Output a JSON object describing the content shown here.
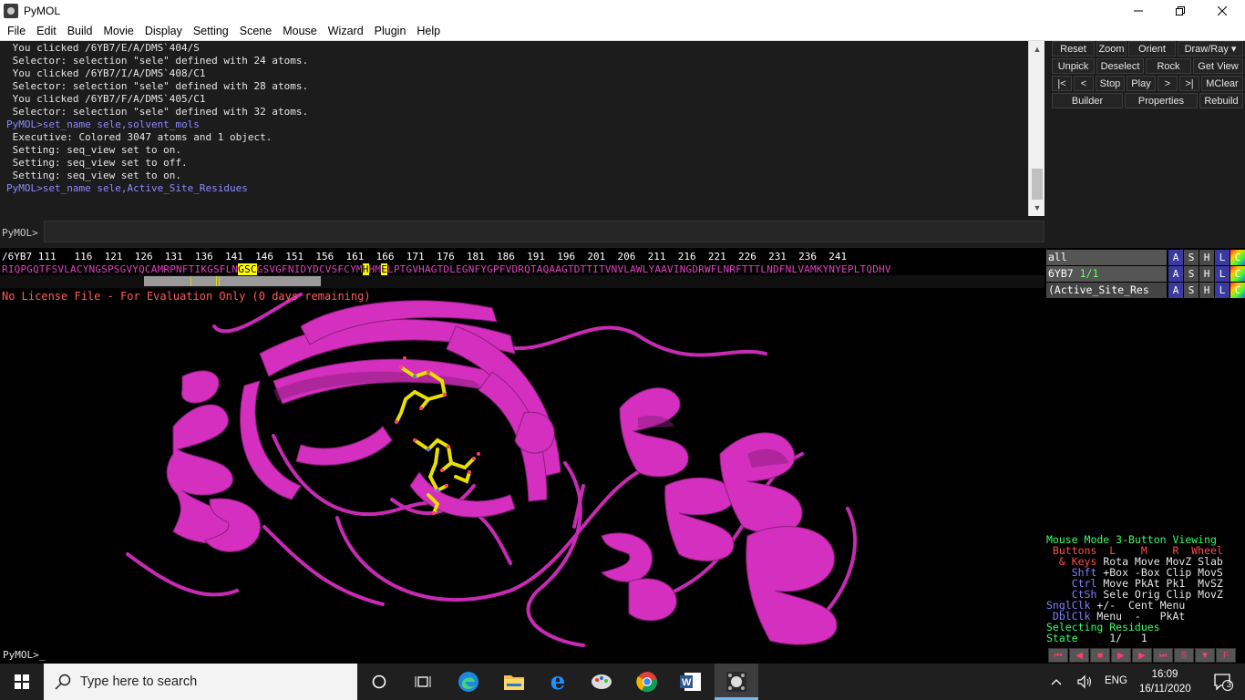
{
  "window": {
    "title": "PyMOL"
  },
  "menubar": [
    "File",
    "Edit",
    "Build",
    "Movie",
    "Display",
    "Setting",
    "Scene",
    "Mouse",
    "Wizard",
    "Plugin",
    "Help"
  ],
  "console": {
    "lines": [
      {
        "text": " You clicked /6YB7/E/A/DMS`404/S",
        "cmd": false
      },
      {
        "text": " Selector: selection \"sele\" defined with 24 atoms.",
        "cmd": false
      },
      {
        "text": " You clicked /6YB7/I/A/DMS`408/C1",
        "cmd": false
      },
      {
        "text": " Selector: selection \"sele\" defined with 28 atoms.",
        "cmd": false
      },
      {
        "text": " You clicked /6YB7/F/A/DMS`405/C1",
        "cmd": false
      },
      {
        "text": " Selector: selection \"sele\" defined with 32 atoms.",
        "cmd": false
      },
      {
        "text": "PyMOL>set_name sele,solvent_mols",
        "cmd": true
      },
      {
        "text": " Executive: Colored 3047 atoms and 1 object.",
        "cmd": false
      },
      {
        "text": " Setting: seq_view set to on.",
        "cmd": false
      },
      {
        "text": " Setting: seq_view set to off.",
        "cmd": false
      },
      {
        "text": " Setting: seq_view set to on.",
        "cmd": false
      },
      {
        "text": "PyMOL>set_name sele,Active_Site_Residues",
        "cmd": true
      }
    ]
  },
  "command": {
    "prompt": "PyMOL>",
    "value": ""
  },
  "buttons": {
    "reset": "Reset",
    "zoom": "Zoom",
    "orient": "Orient",
    "draw_ray": "Draw/Ray ▾",
    "unpick": "Unpick",
    "deselect": "Deselect",
    "rock": "Rock",
    "get_view": "Get View",
    "first": "|<",
    "prev": "<",
    "stop": "Stop",
    "play": "Play",
    "next": ">",
    "last": ">|",
    "mclear": "MClear",
    "builder": "Builder",
    "properties": "Properties",
    "rebuild": "Rebuild"
  },
  "sequence": {
    "numbers": "/6YB7 111   116  121  126  131  136  141  146  151  156  161  166  171  176  181  186  191  196  201  206  211  216  221  226  231  236  241",
    "res_a": "RIQPGQTFSVLACYNGSPSGVYQCAMRPNFTIKGSFLN",
    "res_hl1": "GSC",
    "res_b": "GSVGFNIDYDCVSFCYM",
    "res_hl2": "H",
    "res_c": "HM",
    "res_hl3": "E",
    "res_d": "LPTGVHAGTDLEGNFYGPFVDRQTAQAAGTDTTITVNVLAWLYAAVINGDRWFLNRFTTTLNDFNLVAMKYNYEPLTQDHV"
  },
  "viewport": {
    "license": "No License File - For Evaluation Only (0 days remaining)"
  },
  "objects": [
    {
      "name": "all",
      "state": ""
    },
    {
      "name": "6YB7 ",
      "state": "1/1"
    },
    {
      "name": "(Active_Site_Res",
      "state": ""
    }
  ],
  "obj_buttons": [
    "A",
    "S",
    "H",
    "L",
    "C"
  ],
  "mouse_info": {
    "l1a": "Mouse Mode ",
    "l1b": "3-Button Viewing",
    "l2": " Buttons  L    M    R  Wheel",
    "l3a": "  & Keys ",
    "l3b": "Rota Move MovZ Slab",
    "l4a": "    Shft ",
    "l4b": "+Box -Box Clip MovS",
    "l5a": "    Ctrl ",
    "l5b": "Move PkAt Pk1  MvSZ",
    "l6a": "    CtSh ",
    "l6b": "Sele Orig Clip MovZ",
    "l7a": "SnglClk ",
    "l7b": "+/-  Cent Menu",
    "l8a": " DblClk ",
    "l8b": "Menu  -   PkAt",
    "l9": "Selecting Residues",
    "l10a": "State ",
    "l10b": "    1/   1"
  },
  "bottom": {
    "prompt": "PyMOL>_"
  },
  "taskbar": {
    "search_placeholder": "Type here to search",
    "lang": "ENG",
    "time": "16:09",
    "date": "16/11/2020",
    "notif_count": "3"
  },
  "colors": {
    "cartoon": "#d42fbf",
    "sticks": "#e8e000",
    "accent_red": "#ff4d4d"
  }
}
